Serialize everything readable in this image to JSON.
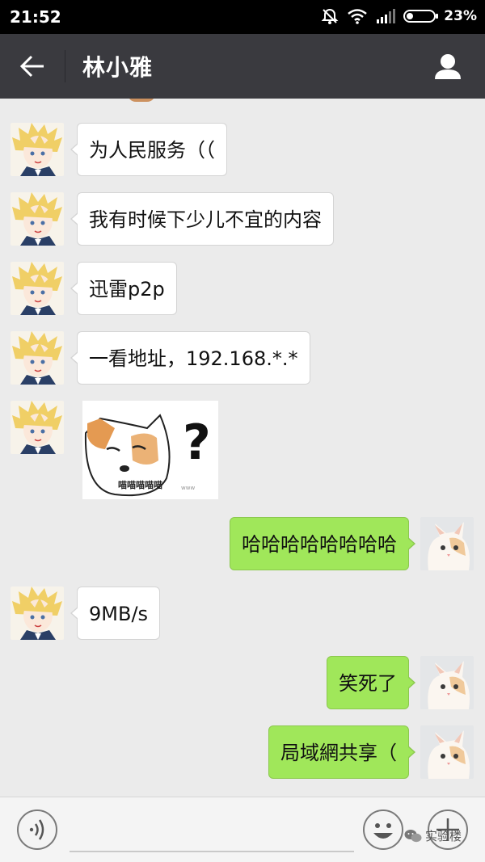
{
  "status_bar": {
    "time": "21:52",
    "battery_percent": "23%"
  },
  "header": {
    "title": "林小雅"
  },
  "messages": [
    {
      "side": "in",
      "type": "text",
      "text": "为人民服务（（"
    },
    {
      "side": "in",
      "type": "text",
      "text": "我有时候下少儿不宜的内容"
    },
    {
      "side": "in",
      "type": "text",
      "text": "迅雷p2p"
    },
    {
      "side": "in",
      "type": "text",
      "text": "一看地址，192.168.*.*"
    },
    {
      "side": "in",
      "type": "sticker",
      "caption": "喵喵喵喵喵",
      "glyph": "?"
    },
    {
      "side": "out",
      "type": "text",
      "text": "哈哈哈哈哈哈哈哈"
    },
    {
      "side": "in",
      "type": "text",
      "text": "9MB/s"
    },
    {
      "side": "out",
      "type": "text",
      "text": "笑死了"
    },
    {
      "side": "out",
      "type": "text",
      "text": "局域網共享（"
    }
  ],
  "watermark": {
    "text": "实验楼"
  },
  "colors": {
    "outgoing_bubble": "#a0e75a",
    "incoming_bubble": "#ffffff",
    "titlebar": "#3a3a3f",
    "chat_background": "#ebebeb"
  }
}
